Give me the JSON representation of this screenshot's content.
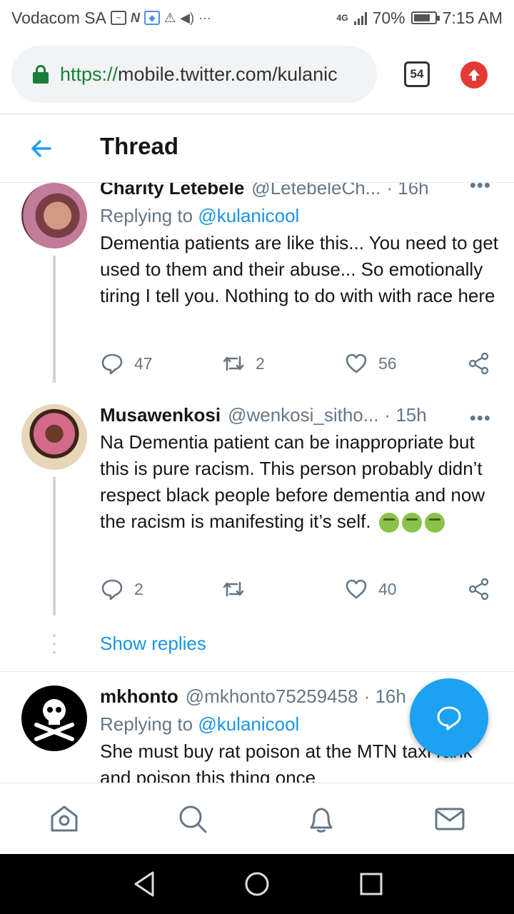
{
  "status_bar": {
    "carrier": "Vodacom SA",
    "network": "4G",
    "battery": "70%",
    "time": "7:15 AM"
  },
  "browser": {
    "url_scheme": "https://",
    "url_rest": "mobile.twitter.com/kulanic",
    "tab_count": "54"
  },
  "header": {
    "title": "Thread"
  },
  "tweets": [
    {
      "name": "Charity Letebele",
      "handle": "@LetebeleCh...",
      "time": "· 16h",
      "replying_prefix": "Replying to ",
      "replying_to": "@kulanicool",
      "text": "Dementia patients are like this... You need to get used to them and their abuse... So emotionally tiring I tell you.  Nothing to do with with race here",
      "replies": "47",
      "retweets": "2",
      "likes": "56"
    },
    {
      "name": "Musawenkosi",
      "handle": "@wenkosi_sitho...",
      "time": "· 15h",
      "text": "Na Dementia patient can be inappropriate but this is pure racism. This person probably didn’t respect black people before dementia and now the racism is manifesting it’s self.",
      "replies": "2",
      "retweets": "",
      "likes": "40"
    },
    {
      "name": "mkhonto",
      "handle": "@mkhonto75259458",
      "time": "· 16h",
      "replying_prefix": "Replying to ",
      "replying_to": "@kulanicool",
      "text": "She must buy rat poison at the MTN taxi rank and poison this thing once"
    }
  ],
  "show_replies": "Show replies",
  "icons": {
    "reply": "reply-icon",
    "retweet": "retweet-icon",
    "like": "heart-icon",
    "share": "share-icon",
    "compose": "compose-icon",
    "home": "home-icon",
    "search": "search-icon",
    "notifications": "bell-icon",
    "messages": "mail-icon"
  },
  "colors": {
    "accent": "#1da1f2",
    "link": "#1b95e0",
    "secondary_text": "#657786"
  }
}
